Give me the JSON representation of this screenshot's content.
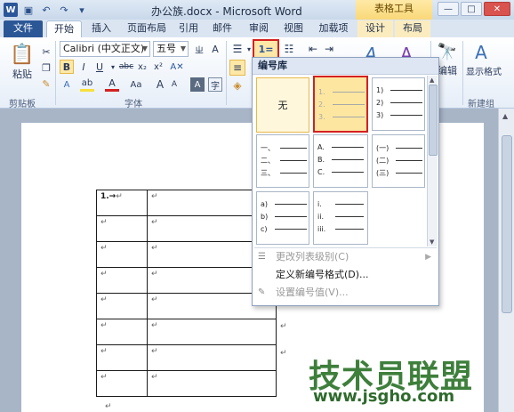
{
  "window": {
    "title": "办公族.docx - Microsoft Word",
    "contextual_tool": "表格工具"
  },
  "tabs": [
    {
      "label": "文件"
    },
    {
      "label": "开始"
    },
    {
      "label": "插入"
    },
    {
      "label": "页面布局"
    },
    {
      "label": "引用"
    },
    {
      "label": "邮件"
    },
    {
      "label": "审阅"
    },
    {
      "label": "视图"
    },
    {
      "label": "加载项"
    },
    {
      "label": "设计"
    },
    {
      "label": "布局"
    }
  ],
  "ribbon": {
    "paste_label": "粘贴",
    "clipboard_label": "剪贴板",
    "font_label": "字体",
    "font_name": "Calibri (中文正文)",
    "font_size": "五号",
    "edit_label": "编辑",
    "show_format_label": "显示格式",
    "new_group_label": "新建组",
    "bold": "B",
    "italic": "I",
    "underline": "U",
    "grow_font": "A",
    "shrink_font": "A",
    "change_case": "Aa",
    "numbering_glyph": "1="
  },
  "dropdown": {
    "header": "编号库",
    "none_label": "无",
    "formats": [
      {
        "lines": [
          "1.",
          "2.",
          "3."
        ]
      },
      {
        "lines": [
          "1)",
          "2)",
          "3)"
        ]
      },
      {
        "lines": [
          "一、",
          "二、",
          "三、"
        ]
      },
      {
        "lines": [
          "A.",
          "B.",
          "C."
        ]
      },
      {
        "lines": [
          "(一)",
          "(二)",
          "(三)"
        ]
      },
      {
        "lines": [
          "a)",
          "b)",
          "c)"
        ]
      },
      {
        "lines": [
          "i.",
          "ii.",
          "iii."
        ]
      }
    ],
    "items": [
      {
        "label": "更改列表级别(C)",
        "disabled": true
      },
      {
        "label": "定义新编号格式(D)...",
        "disabled": false
      },
      {
        "label": "设置编号值(V)...",
        "disabled": true
      }
    ]
  },
  "document": {
    "first_cell_text": "1.→",
    "mark": "↵"
  },
  "watermark": {
    "text": "技术员联盟",
    "url": "www.jsgho.com"
  }
}
